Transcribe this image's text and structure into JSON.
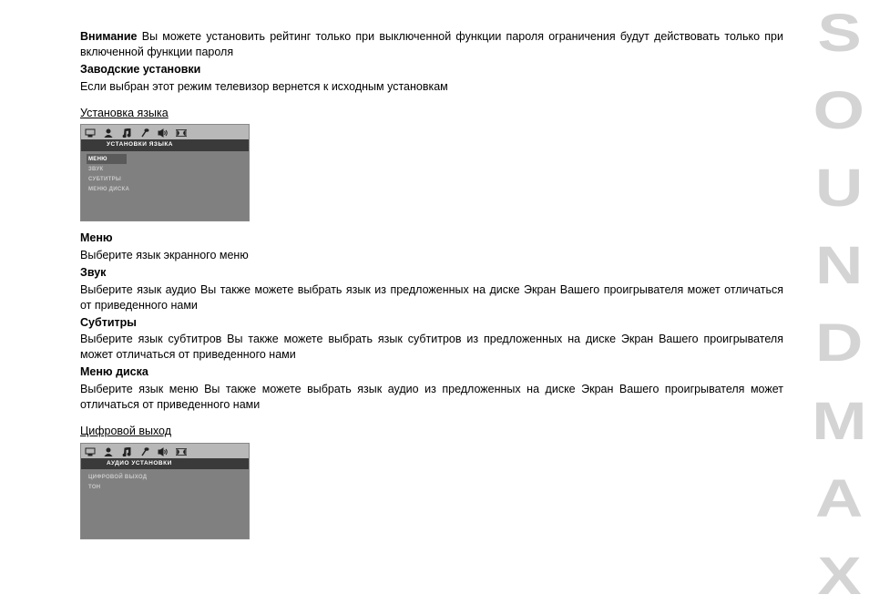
{
  "brand": "SOUNDMAX",
  "attention": {
    "label": "Внимание",
    "text": "Вы можете установить рейтинг только при выключенной функции пароля  ограничения будут действовать только при включенной функции пароля"
  },
  "factory": {
    "label": "Заводские установки",
    "text": "Если выбран этот режим  телевизор вернется к исходным установкам"
  },
  "lang_section": {
    "heading": "Установка языка",
    "osd_title": "УСТАНОВКИ ЯЗЫКА",
    "osd_items": [
      "МЕНЮ",
      "ЗВУК",
      "СУБТИТРЫ",
      "МЕНЮ ДИСКА"
    ]
  },
  "menu": {
    "label": "Меню",
    "text": "Выберите язык экранного меню"
  },
  "sound": {
    "label": "Звук",
    "text": "Выберите язык аудио  Вы также можете выбрать язык из предложенных на        диске  Экран Вашего проигрывателя может отличаться от приведенного нами"
  },
  "subs": {
    "label": "Субтитры",
    "text": "Выберите язык субтитров  Вы также можете выбрать язык субтитров из предложенных на        диске  Экран Вашего проигрывателя может отличаться от приведенного нами"
  },
  "disc_menu": {
    "label": "Меню диска",
    "text": "Выберите язык меню  Вы также можете выбрать язык аудио из предложенных на        диске  Экран Вашего проигрывателя может отличаться от приведенного нами"
  },
  "digital_out": {
    "heading": "Цифровой выход",
    "osd_title": "АУДИО УСТАНОВКИ",
    "osd_items": [
      "ЦИФРОВОЙ ВЫХОД",
      "ТОН"
    ]
  }
}
